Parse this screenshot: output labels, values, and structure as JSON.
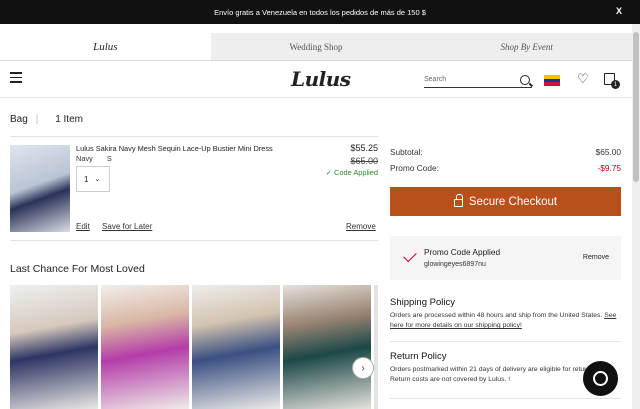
{
  "topbar": {
    "message": "Envío gratis a Venezuela en todos los pedidos de más de 150 $",
    "close": "X"
  },
  "brand_tabs": [
    {
      "label": "Lulus"
    },
    {
      "label": "Wedding Shop"
    },
    {
      "label": "Shop By Event"
    }
  ],
  "header": {
    "logo": "Lulus",
    "search_placeholder": "Search",
    "bag_count": "1",
    "flag_colors": [
      "#f4c300",
      "#0a3a9f",
      "#cf142b"
    ]
  },
  "bag": {
    "title": "Bag",
    "item_count": "1 Item",
    "item": {
      "name": "Lulus Sakira Navy Mesh Sequin Lace-Up Bustier Mini Dress",
      "color": "Navy",
      "size": "S",
      "qty": "1",
      "price": "$55.25",
      "original_price": "$65.00",
      "promo_label": "✓ Code Applied",
      "edit": "Edit",
      "save_later": "Save for Later",
      "remove": "Remove"
    }
  },
  "recommendations": {
    "title": "Last Chance For Most Loved",
    "next": "›"
  },
  "summary": {
    "subtotal_label": "Subtotal:",
    "subtotal_value": "$65.00",
    "promo_label": "Promo Code:",
    "promo_value": "-$9.75",
    "checkout": "Secure Checkout",
    "promo_box_title": "Promo Code Applied",
    "promo_box_code": "glowingeyes6897nu",
    "promo_box_remove": "Remove"
  },
  "policies": {
    "shipping_title": "Shipping Policy",
    "shipping_text": "Orders are processed within 48 hours and ship from the United States.",
    "shipping_link": "See here for more details on our shipping policy!",
    "return_title": "Return Policy",
    "return_text": "Orders postmarked within 21 days of delivery are eligible for returned. Return costs are not covered by Lulus. !"
  },
  "colors": {
    "checkout": "#b9501c",
    "discount": "#c4001a",
    "success": "#2c8a2c"
  }
}
